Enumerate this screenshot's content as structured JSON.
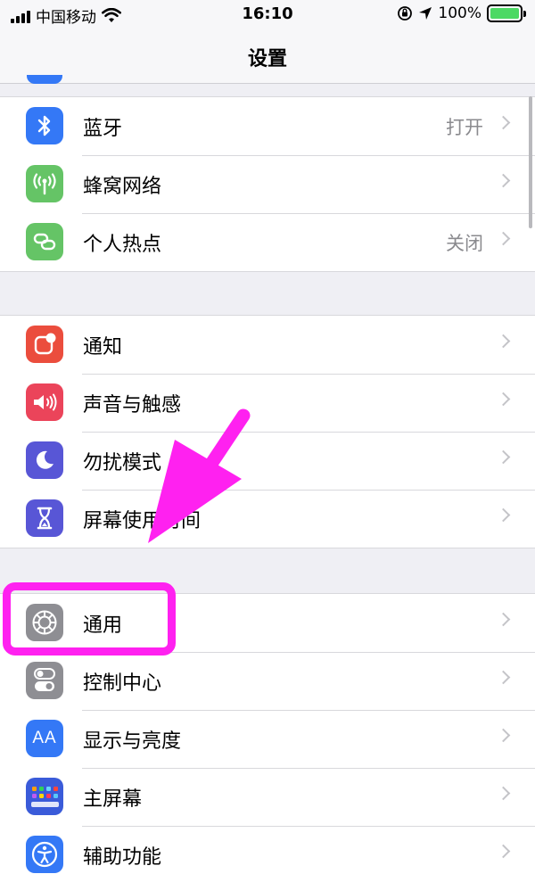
{
  "status": {
    "carrier": "中国移动",
    "time": "16:10",
    "battery": "100%"
  },
  "nav": {
    "title": "设置"
  },
  "groups": [
    {
      "items": [
        {
          "label": "蓝牙",
          "value": "打开",
          "icon": "bluetooth-icon",
          "color": "#3478f6"
        },
        {
          "label": "蜂窝网络",
          "icon": "cellular-antenna-icon",
          "color": "#65c466"
        },
        {
          "label": "个人热点",
          "value": "关闭",
          "icon": "hotspot-link-icon",
          "color": "#65c466"
        }
      ]
    },
    {
      "items": [
        {
          "label": "通知",
          "icon": "notification-icon",
          "color": "#eb4d3d"
        },
        {
          "label": "声音与触感",
          "icon": "speaker-icon",
          "color": "#eb445a"
        },
        {
          "label": "勿扰模式",
          "icon": "moon-icon",
          "color": "#5856d6"
        },
        {
          "label": "屏幕使用时间",
          "icon": "hourglass-icon",
          "color": "#5856d6"
        }
      ]
    },
    {
      "items": [
        {
          "label": "通用",
          "icon": "gear-icon",
          "color": "#8e8e93"
        },
        {
          "label": "控制中心",
          "icon": "toggle-switches-icon",
          "color": "#8e8e93"
        },
        {
          "label": "显示与亮度",
          "icon": "text-size-icon",
          "glyph": "AA",
          "color": "#3478f6"
        },
        {
          "label": "主屏幕",
          "icon": "app-grid-icon",
          "color": "#3a5bd9"
        },
        {
          "label": "辅助功能",
          "icon": "accessibility-icon",
          "color": "#3478f6"
        }
      ]
    }
  ],
  "annotation_color": "#ff21f0"
}
